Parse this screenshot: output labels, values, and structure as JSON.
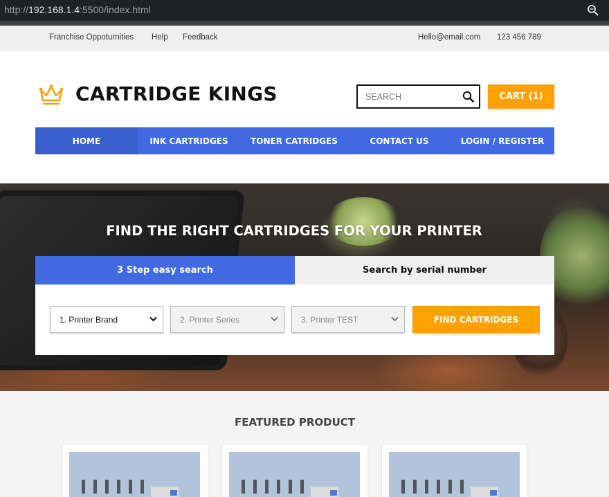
{
  "browser": {
    "url_prefix": "http://",
    "url_host": "192.168.1.4",
    "url_suffix": ":5500/index.html"
  },
  "topbar": {
    "franchise": "Franchise Oppoturnities",
    "help": "Help",
    "feedback": "Feedback",
    "email": "Hello@email.com",
    "phone": "123 456 789"
  },
  "header": {
    "brand": "CARTRIDGE KINGS",
    "search_placeholder": "SEARCH",
    "cart_label": "CART (1)"
  },
  "nav": {
    "items": [
      {
        "label": "HOME"
      },
      {
        "label": "INK CARTRIDGES"
      },
      {
        "label": "TONER CATRIDGES"
      },
      {
        "label": "CONTACT US"
      },
      {
        "label": "LOGIN / REGISTER"
      }
    ]
  },
  "hero": {
    "title": "FIND THE RIGHT CARTRIDGES FOR YOUR PRINTER",
    "tab_a": "3 Step easy search",
    "tab_b": "Search by serial number",
    "select_brand": "1. Printer Brand",
    "select_series": "2. Printer Series",
    "select_model": "3. Printer TEST",
    "find_label": "FIND CARTRIDGES"
  },
  "featured": {
    "title": "FEATURED PRODUCT"
  },
  "colors": {
    "accent_orange": "#ffa200",
    "nav_blue": "#4169e1",
    "logo_gold": "#f0a202"
  },
  "icons": {
    "logo": "crown-icon",
    "search": "search-icon",
    "zoom": "zoom-icon",
    "select": "chevron-down-icon"
  }
}
